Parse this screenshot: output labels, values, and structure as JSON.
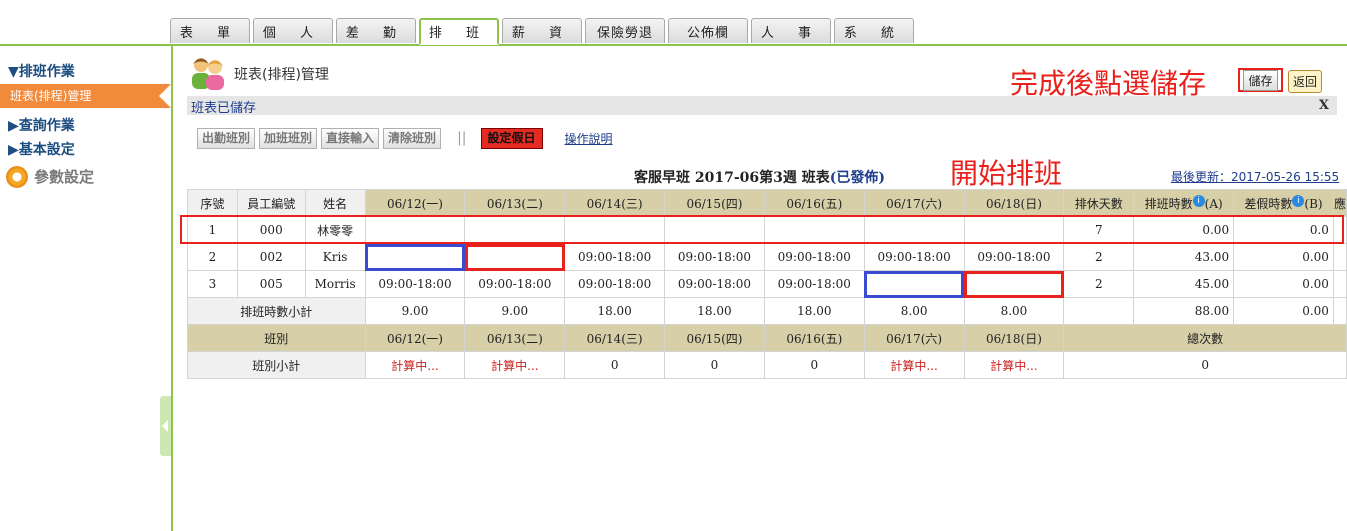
{
  "topnav": {
    "tabs": [
      {
        "label": "表 單",
        "active": false
      },
      {
        "label": "個 人",
        "active": false
      },
      {
        "label": "差 勤",
        "active": false
      },
      {
        "label": "排 班",
        "active": true
      },
      {
        "label": "薪 資",
        "active": false
      },
      {
        "label": "保險勞退",
        "active": false
      },
      {
        "label": "公佈欄",
        "active": false
      },
      {
        "label": "人 事",
        "active": false
      },
      {
        "label": "系 統",
        "active": false
      }
    ]
  },
  "sidebar": {
    "section_schedule": "▼排班作業",
    "item_active": "班表(排程)管理",
    "section_query": "▶查詢作業",
    "section_basic": "▶基本設定",
    "section_param": "參數設定"
  },
  "header": {
    "title": "班表(排程)管理",
    "annotation_save": "完成後點選儲存",
    "save_label": "儲存",
    "back_label": "返回"
  },
  "status": {
    "message": "班表已儲存",
    "close": "X"
  },
  "toolbar": {
    "btn_attend": "出勤班別",
    "btn_overtime": "加班班別",
    "btn_direct": "直接輸入",
    "btn_clear": "清除班別",
    "separator": "||",
    "btn_holiday": "設定假日",
    "help_link": "操作說明"
  },
  "schedule": {
    "title_prefix": "客服早班 2017-06第3週 班表",
    "title_status": "(已發佈)",
    "annotation_start": "開始排班",
    "last_update": "最後更新：2017-05-26 15:55",
    "headers": {
      "seq": "序號",
      "emp_id": "員工編號",
      "name": "姓名",
      "days": [
        "06/12(一)",
        "06/13(二)",
        "06/14(三)",
        "06/15(四)",
        "06/16(五)",
        "06/17(六)",
        "06/18(日)"
      ],
      "rest_days": "排休天數",
      "sched_hours": "排班時數",
      "sched_hours_suffix": "(A)",
      "leave_hours": "差假時數",
      "leave_hours_suffix": "(B)",
      "extra": "應",
      "info_icon": "i"
    },
    "rows": [
      {
        "seq": "1",
        "emp_id": "000",
        "name": "林零零",
        "days": [
          "",
          "",
          "",
          "",
          "",
          "",
          ""
        ],
        "rest_days": "7",
        "sched_hours": "0.00",
        "leave_hours": "0.0"
      },
      {
        "seq": "2",
        "emp_id": "002",
        "name": "Kris",
        "days": [
          "",
          "",
          "09:00-18:00",
          "09:00-18:00",
          "09:00-18:00",
          "09:00-18:00",
          "09:00-18:00"
        ],
        "rest_days": "2",
        "sched_hours": "43.00",
        "leave_hours": "0.00"
      },
      {
        "seq": "3",
        "emp_id": "005",
        "name": "Morris",
        "days": [
          "09:00-18:00",
          "09:00-18:00",
          "09:00-18:00",
          "09:00-18:00",
          "09:00-18:00",
          "",
          ""
        ],
        "rest_days": "2",
        "sched_hours": "45.00",
        "leave_hours": "0.00"
      }
    ],
    "subtotal": {
      "label": "排班時數小計",
      "days": [
        "9.00",
        "9.00",
        "18.00",
        "18.00",
        "18.00",
        "8.00",
        "8.00"
      ],
      "sched_hours": "88.00",
      "leave_hours": "0.00"
    },
    "shift_header": {
      "label": "班別",
      "days": [
        "06/12(一)",
        "06/13(二)",
        "06/14(三)",
        "06/15(四)",
        "06/16(五)",
        "06/17(六)",
        "06/18(日)"
      ],
      "total_label": "總次數"
    },
    "shift_subtotal": {
      "label": "班別小計",
      "days": [
        "計算中...",
        "計算中...",
        "0",
        "0",
        "0",
        "計算中...",
        "計算中..."
      ],
      "total": "0"
    }
  },
  "colors": {
    "accent_green": "#8cc34a",
    "sidebar_active": "#f28a3c",
    "annotation_red": "#e8211c",
    "table_header": "#d6cfa8",
    "link_blue": "#1f3d8c"
  }
}
